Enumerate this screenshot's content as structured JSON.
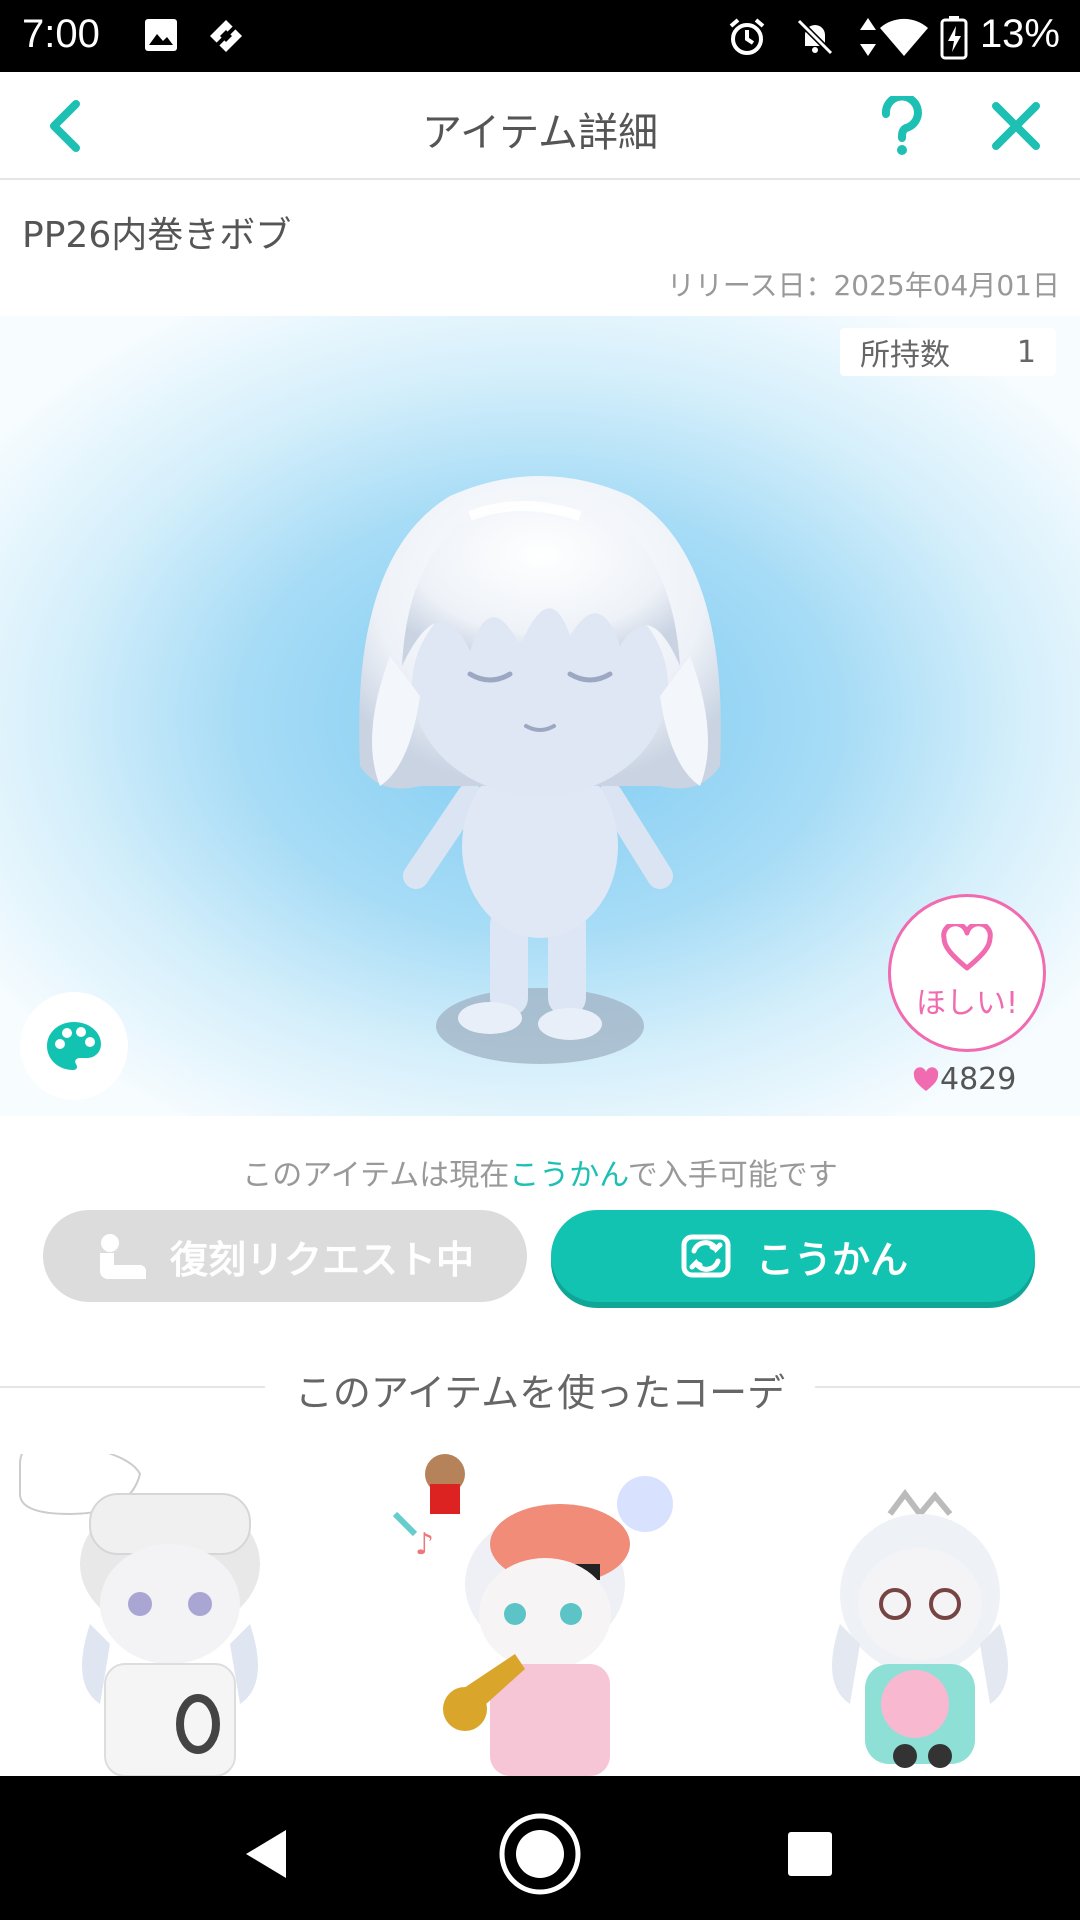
{
  "status_bar": {
    "time": "7:00",
    "battery": "13%",
    "icons": [
      "image-icon",
      "diamond-app-icon",
      "alarm-icon",
      "bell-off-icon",
      "data-arrows-icon",
      "wifi-icon",
      "battery-charging-icon"
    ]
  },
  "header": {
    "title": "アイテム詳細",
    "back_icon": "chevron-left-icon",
    "help_icon": "question-icon",
    "close_icon": "close-icon",
    "accent": "#1ec0b4"
  },
  "item": {
    "name": "PP26内巻きボブ",
    "release": "リリース日：2025年04月01日",
    "owned_label": "所持数",
    "owned_count": "1"
  },
  "want": {
    "label": "ほしい!",
    "count": "4829",
    "color": "#f06bb0"
  },
  "availability": {
    "prefix": "このアイテムは現在",
    "highlight": "こうかん",
    "suffix": "で入手可能です"
  },
  "actions": {
    "request_label": "復刻リクエスト中",
    "exchange_label": "こうかん",
    "exchange_color": "#13c3b1"
  },
  "coords": {
    "title": "このアイテムを使ったコーデ"
  }
}
